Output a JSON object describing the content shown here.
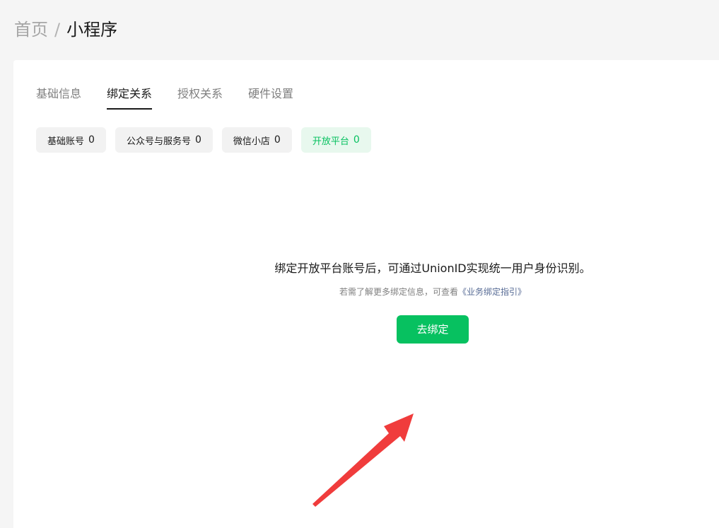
{
  "breadcrumb": {
    "home": "首页",
    "separator": "/",
    "current": "小程序"
  },
  "tabs": [
    {
      "label": "基础信息",
      "active": false
    },
    {
      "label": "绑定关系",
      "active": true
    },
    {
      "label": "授权关系",
      "active": false
    },
    {
      "label": "硬件设置",
      "active": false
    }
  ],
  "subtabs": [
    {
      "label": "基础账号",
      "count": "0",
      "active": false
    },
    {
      "label": "公众号与服务号",
      "count": "0",
      "active": false
    },
    {
      "label": "微信小店",
      "count": "0",
      "active": false
    },
    {
      "label": "开放平台",
      "count": "0",
      "active": true
    }
  ],
  "empty_state": {
    "message": "绑定开放平台账号后，可通过UnionID实现统一用户身份识别。",
    "hint_prefix": "若需了解更多绑定信息，可查看",
    "hint_link": "《业务绑定指引》",
    "button_label": "去绑定"
  },
  "colors": {
    "accent": "#07c160",
    "accent_bg": "#e8f8ee",
    "link": "#576b95",
    "annotation_arrow": "#f03c3c"
  }
}
